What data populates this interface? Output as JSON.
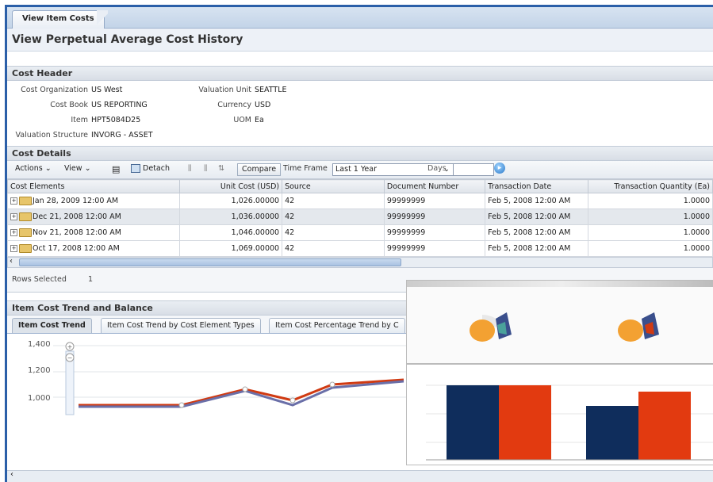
{
  "tab": {
    "title": "View Item Costs"
  },
  "page_title": "View Perpetual Average Cost History",
  "cost_header": {
    "section_title": "Cost Header",
    "left_fields": [
      {
        "label": "Cost Organization",
        "value": "US West"
      },
      {
        "label": "Cost Book",
        "value": "US REPORTING"
      },
      {
        "label": "Item",
        "value": "HPT5084D25"
      },
      {
        "label": "Valuation Structure",
        "value": "INVORG - ASSET"
      }
    ],
    "right_fields": [
      {
        "label": "Valuation Unit",
        "value": "SEATTLE"
      },
      {
        "label": "Currency",
        "value": "USD"
      },
      {
        "label": "UOM",
        "value": "Ea"
      }
    ]
  },
  "cost_details": {
    "section_title": "Cost Details",
    "toolbar": {
      "actions_label": "Actions",
      "view_label": "View",
      "detach_label": "Detach",
      "compare_label": "Compare",
      "time_frame_label": "Time Frame",
      "time_frame_value": "Last 1 Year",
      "days_label": "Days",
      "days_value": ""
    },
    "columns": [
      "Cost Elements",
      "Unit Cost (USD)",
      "Source",
      "Document Number",
      "Transaction Date",
      "Transaction Quantity (Ea)"
    ],
    "rows": [
      {
        "element": "Jan 28, 2009 12:00 AM",
        "unit_cost": "1,026.00000",
        "source": "42",
        "doc": "99999999",
        "date": "Feb 5, 2008 12:00 AM",
        "qty": "1.0000"
      },
      {
        "element": "Dec 21, 2008 12:00 AM",
        "unit_cost": "1,036.00000",
        "source": "42",
        "doc": "99999999",
        "date": "Feb 5, 2008 12:00 AM",
        "qty": "1.0000"
      },
      {
        "element": "Nov 21, 2008 12:00 AM",
        "unit_cost": "1,046.00000",
        "source": "42",
        "doc": "99999999",
        "date": "Feb 5, 2008 12:00 AM",
        "qty": "1.0000"
      },
      {
        "element": "Oct 17, 2008 12:00 AM",
        "unit_cost": "1,069.00000",
        "source": "42",
        "doc": "99999999",
        "date": "Feb 5, 2008 12:00 AM",
        "qty": "1.0000"
      }
    ],
    "rows_selected_label": "Rows Selected",
    "rows_selected_value": "1"
  },
  "trend": {
    "section_title": "Item Cost Trend and Balance",
    "tabs": [
      "Item Cost Trend",
      "Item Cost Trend by Cost Element Types",
      "Item Cost Percentage Trend by C"
    ],
    "y_ticks": [
      "1,400",
      "1,200",
      "1,000"
    ]
  },
  "colors": {
    "accent": "#2b5fa8",
    "line_series": "#6a6fa8",
    "red_series": "#d03a12",
    "navy_bar": "#0f2d5c",
    "red_bar": "#e23a10"
  }
}
